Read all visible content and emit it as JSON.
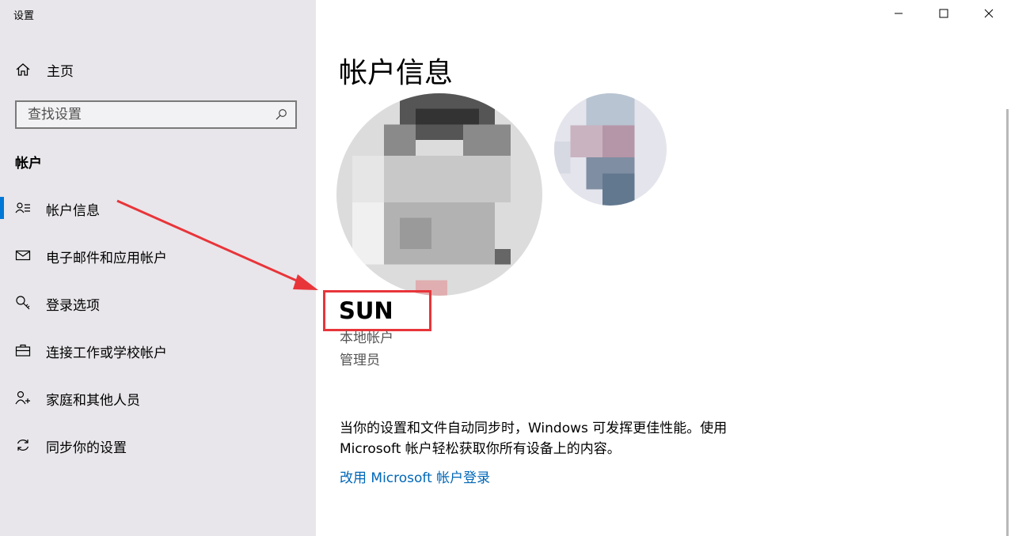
{
  "app": {
    "title": "设置"
  },
  "sidebar": {
    "home_label": "主页",
    "search_placeholder": "查找设置",
    "section_title": "帐户",
    "items": [
      {
        "label": "帐户信息",
        "icon": "account-info-icon",
        "selected": true
      },
      {
        "label": "电子邮件和应用帐户",
        "icon": "mail-icon",
        "selected": false
      },
      {
        "label": "登录选项",
        "icon": "key-icon",
        "selected": false
      },
      {
        "label": "连接工作或学校帐户",
        "icon": "briefcase-icon",
        "selected": false
      },
      {
        "label": "家庭和其他人员",
        "icon": "add-person-icon",
        "selected": false
      },
      {
        "label": "同步你的设置",
        "icon": "sync-icon",
        "selected": false
      }
    ]
  },
  "main": {
    "title": "帐户信息",
    "user_name": "SUN",
    "account_type": "本地帐户",
    "account_role": "管理员",
    "description": "当你的设置和文件自动同步时，Windows 可发挥更佳性能。使用 Microsoft 帐户轻松获取你所有设备上的内容。",
    "link_text": "改用 Microsoft 帐户登录"
  },
  "colors": {
    "accent": "#0078d7",
    "link": "#0067b8",
    "annotation": "#e8353a",
    "sidebar_bg": "#e8e6ea"
  }
}
